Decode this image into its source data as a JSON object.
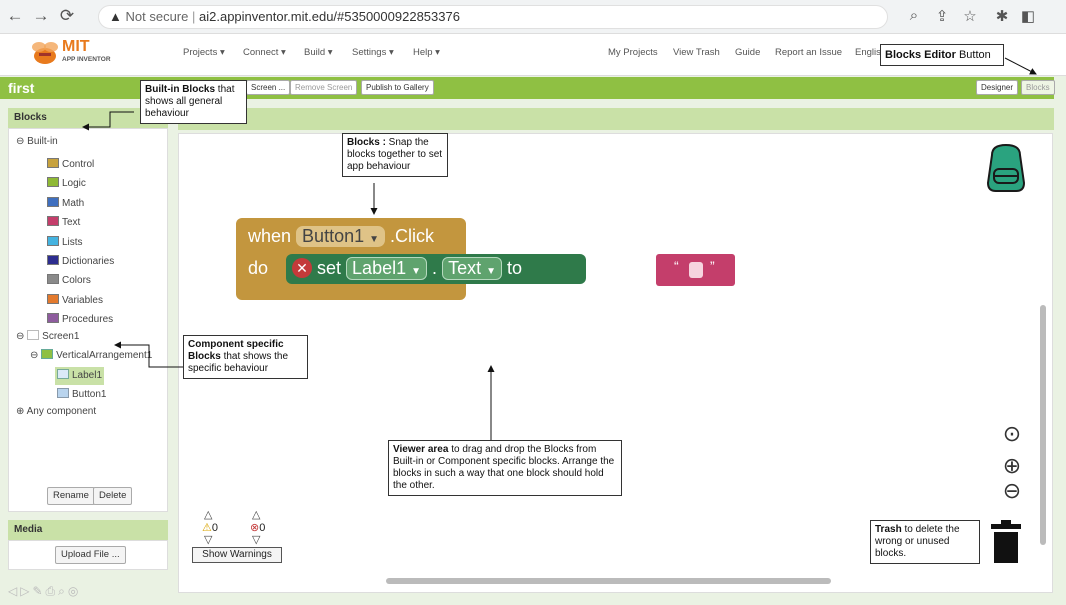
{
  "browser": {
    "security": "Not secure",
    "url": "ai2.appinventor.mit.edu/#5350000922853376"
  },
  "header": {
    "logo_line1": "MIT",
    "logo_line2": "APP INVENTOR",
    "menus": [
      "Projects ▾",
      "Connect ▾",
      "Build ▾",
      "Settings ▾",
      "Help ▾"
    ],
    "links": [
      "My Projects",
      "View Trash",
      "Guide",
      "Report an Issue",
      "Englis"
    ]
  },
  "toolbar": {
    "project_name": "first",
    "buttons": [
      "Screen ...",
      "Remove Screen",
      "Publish to Gallery"
    ],
    "designer": "Designer",
    "blocks": "Blocks"
  },
  "panel": {
    "title": "Blocks",
    "builtin": "Built-in",
    "builtin_items": [
      {
        "label": "Control",
        "color": "#c7a23e"
      },
      {
        "label": "Logic",
        "color": "#8fb935"
      },
      {
        "label": "Math",
        "color": "#3f6fbf"
      },
      {
        "label": "Text",
        "color": "#c43e6b"
      },
      {
        "label": "Lists",
        "color": "#44b3e0"
      },
      {
        "label": "Dictionaries",
        "color": "#2d2d8f"
      },
      {
        "label": "Colors",
        "color": "#8a8a8a"
      },
      {
        "label": "Variables",
        "color": "#e37a2e"
      },
      {
        "label": "Procedures",
        "color": "#8e5c9e"
      }
    ],
    "screen": "Screen1",
    "arrangement": "VerticalArrangement1",
    "label": "Label1",
    "button": "Button1",
    "any": "Any component",
    "rename": "Rename",
    "delete": "Delete"
  },
  "media": {
    "title": "Media",
    "upload": "Upload File ..."
  },
  "blocks": {
    "when": "when",
    "button": "Button1",
    "click": ".Click",
    "do": "do",
    "set": "set",
    "label": "Label1",
    "dot": ".",
    "text": "Text",
    "to": "to",
    "str_open": "“",
    "str_close": "”"
  },
  "warnings": {
    "warn_count": "0",
    "err_count": "0",
    "show": "Show Warnings"
  },
  "annotations": {
    "editor_bold": "Blocks Editor",
    "editor_rest": " Button",
    "builtin_bold": "Built-in Blocks",
    "builtin_rest": " that shows all general behaviour",
    "blocks_bold": "Blocks :",
    "blocks_rest": " Snap the blocks together to set app behaviour",
    "comp_bold": "Component specific Blocks",
    "comp_rest": " that shows the specific behaviour",
    "viewer_bold": "Viewer area",
    "viewer_rest": " to drag and drop the Blocks from Built-in or Component specific blocks. Arrange the blocks in such a way that one block should hold the other.",
    "trash_bold": "Trash",
    "trash_rest": " to delete the wrong or unused blocks."
  },
  "colors": {
    "toolbar_green": "#8fc043",
    "event_block": "#c3963e",
    "set_block": "#2f7a4a",
    "text_block": "#c43e6b"
  }
}
